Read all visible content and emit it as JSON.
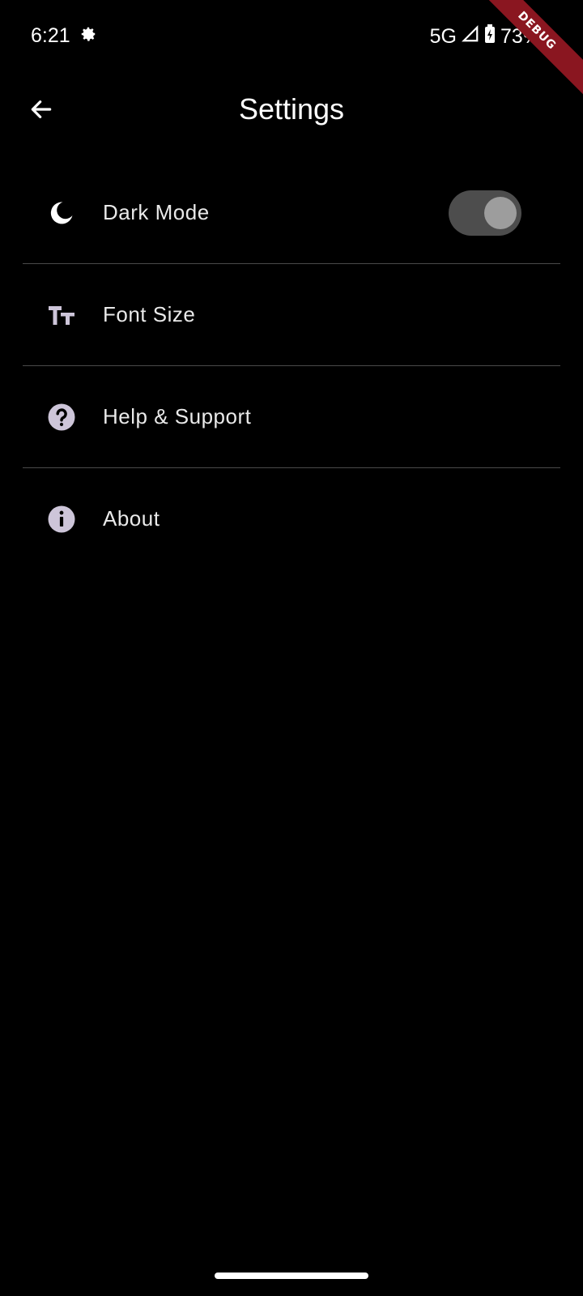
{
  "status_bar": {
    "time": "6:21",
    "network": "5G",
    "battery": "73%"
  },
  "debug_banner": "DEBUG",
  "app_bar": {
    "title": "Settings",
    "back_icon": "arrow-back-icon"
  },
  "settings": [
    {
      "label": "Dark Mode",
      "icon": "moon-icon",
      "toggle": true
    },
    {
      "label": "Font Size",
      "icon": "text-size-icon"
    },
    {
      "label": "Help & Support",
      "icon": "help-circle-icon"
    },
    {
      "label": "About",
      "icon": "info-icon"
    }
  ],
  "colors": {
    "background": "#000000",
    "text": "#ffffff",
    "icon_tint": "#cdc5d9",
    "divider": "#4a4a4a",
    "switch_track": "#4d4d4d",
    "switch_thumb": "#9d9d9d",
    "debug_banner": "#8a1620"
  }
}
